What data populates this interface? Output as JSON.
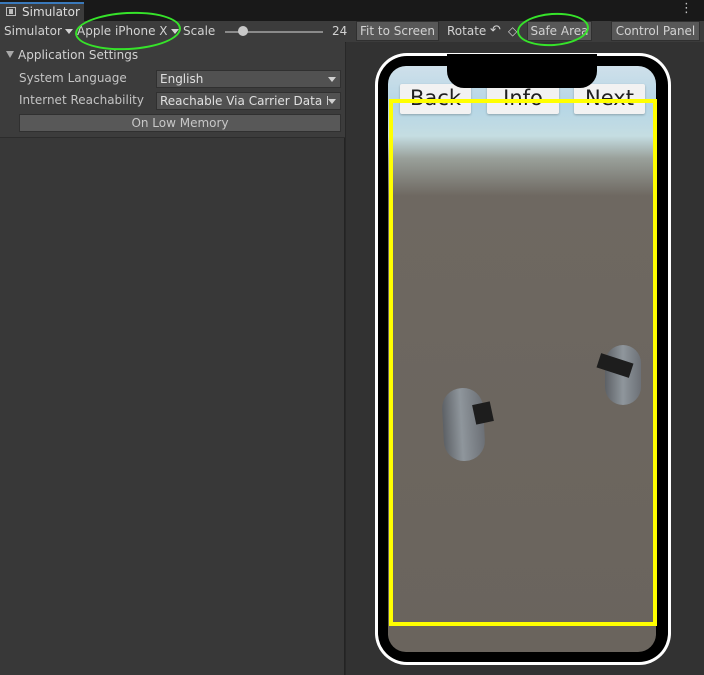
{
  "window": {
    "tab_title": "Simulator",
    "menu_icon": "kebab-menu-icon"
  },
  "toolbar": {
    "mode": "Simulator",
    "device": "Apple iPhone X",
    "scale_label": "Scale",
    "scale_value": "24",
    "fit_to_screen": "Fit to Screen",
    "rotate_label": "Rotate",
    "safe_area": "Safe Area",
    "control_panel": "Control Panel"
  },
  "settings": {
    "section_title": "Application Settings",
    "system_language_label": "System Language",
    "system_language_value": "English",
    "internet_reachability_label": "Internet Reachability",
    "internet_reachability_value": "Reachable Via Carrier Data Network",
    "low_memory_button": "On Low Memory"
  },
  "game": {
    "buttons": [
      {
        "label": "Back"
      },
      {
        "label": "Info"
      },
      {
        "label": "Next"
      }
    ]
  },
  "colors": {
    "safe_area_outline": "#ffff00",
    "annotation_circle": "#36e32a",
    "tab_accent": "#3a79bb"
  }
}
